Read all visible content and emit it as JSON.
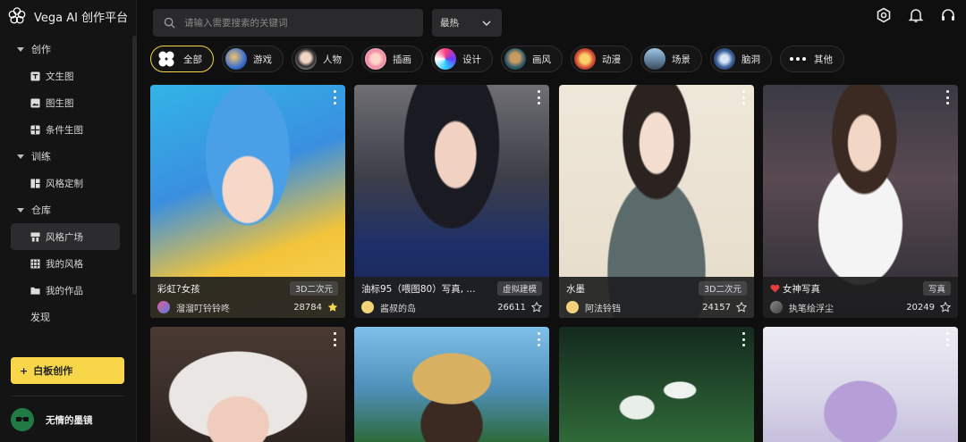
{
  "app": {
    "title": "Vega AI 创作平台"
  },
  "sidebar": {
    "sections": [
      {
        "label": "创作",
        "items": [
          {
            "label": "文生图"
          },
          {
            "label": "图生图"
          },
          {
            "label": "条件生图"
          }
        ]
      },
      {
        "label": "训练",
        "items": [
          {
            "label": "风格定制"
          }
        ]
      },
      {
        "label": "仓库",
        "items": [
          {
            "label": "风格广场"
          },
          {
            "label": "我的风格"
          },
          {
            "label": "我的作品"
          }
        ]
      }
    ],
    "discover": "发现",
    "create_button": "白板创作",
    "user_name": "无情的墨镜"
  },
  "header": {
    "search_placeholder": "请输入需要搜索的关键词",
    "sort_value": "最热"
  },
  "categories": [
    "全部",
    "游戏",
    "人物",
    "插画",
    "设计",
    "画风",
    "动漫",
    "场景",
    "脑洞",
    "其他"
  ],
  "cards": [
    {
      "title": "彩虹?女孩",
      "tag": "3D二次元",
      "author": "溜溜叮铃铃咚",
      "count": "28784",
      "starred": true
    },
    {
      "title": "油标95（喂图80）写真, ...",
      "tag": "虚拟建模",
      "author": "酱叔的岛",
      "count": "26611",
      "starred": false
    },
    {
      "title": "水墨",
      "tag": "3D二次元",
      "author": "阿法铃铛",
      "count": "24157",
      "starred": false
    },
    {
      "title": "女神写真",
      "tag": "写真",
      "author": "执笔绘浮尘",
      "count": "20249",
      "starred": false
    }
  ],
  "colors": {
    "accent": "#f7d64a",
    "bg": "#0f0f10",
    "sidebar": "#141415"
  }
}
